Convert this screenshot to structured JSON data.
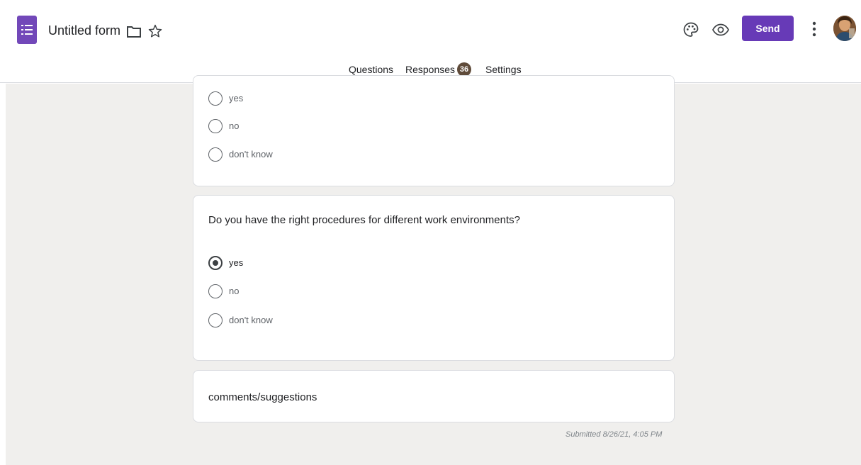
{
  "header": {
    "form_title": "Untitled form",
    "send_label": "Send",
    "icons": [
      "forms-logo-icon",
      "folder-icon",
      "star-icon",
      "palette-icon",
      "eye-icon",
      "more-vert-icon",
      "avatar"
    ]
  },
  "tabs": {
    "questions": "Questions",
    "responses": "Responses",
    "responses_count": "36",
    "settings": "Settings",
    "active": "responses"
  },
  "cards": {
    "q1_options": [
      "yes",
      "no",
      "don't know"
    ],
    "q2": {
      "question": "Do you have the right procedures for different work environments?",
      "options": [
        "yes",
        "no",
        "don't know"
      ],
      "selected": "yes"
    },
    "q3": {
      "title": "comments/suggestions"
    }
  },
  "submitted": "Submitted 8/26/21, 4:05 PM",
  "colors": {
    "brand": "#673ab7",
    "logo": "#7248b9",
    "badge": "#5f4b3a",
    "background": "#f0efed"
  }
}
